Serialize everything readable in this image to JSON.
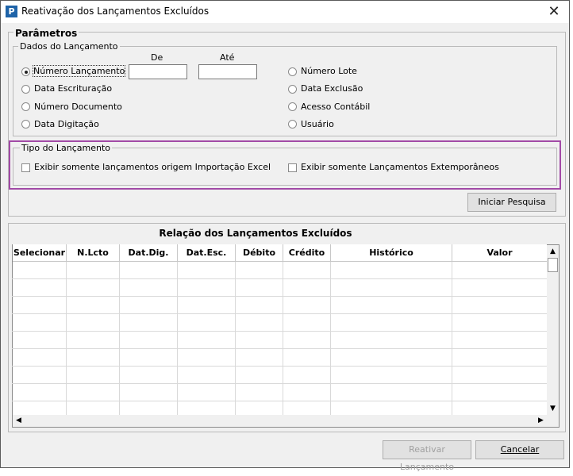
{
  "window": {
    "title": "Reativação dos Lançamentos Excluídos",
    "close_glyph": "✕",
    "app_icon_letter": "P"
  },
  "params": {
    "title": "Parâmetros",
    "dados": {
      "legend": "Dados do Lançamento",
      "col_de": "De",
      "col_ate": "Até",
      "left_options": [
        "Número Lançamento",
        "Data Escrituração",
        "Número Documento",
        "Data Digitação"
      ],
      "right_options": [
        "Número Lote",
        "Data Exclusão",
        "Acesso Contábil",
        "Usuário"
      ],
      "de_value": "",
      "ate_value": ""
    },
    "tipo": {
      "legend": "Tipo do Lançamento",
      "opt1": "Exibir somente lançamentos origem Importação Excel",
      "opt2": "Exibir somente Lançamentos Extemporâneos"
    },
    "search_button": "Iniciar Pesquisa"
  },
  "relacao": {
    "title": "Relação dos Lançamentos Excluídos",
    "columns": [
      "Selecionar",
      "N.Lcto",
      "Dat.Dig.",
      "Dat.Esc.",
      "Débito",
      "Crédito",
      "Histórico",
      "Valor"
    ],
    "rows": []
  },
  "footer": {
    "reativar": "Reativar Lançamento",
    "cancelar": "Cancelar"
  },
  "colors": {
    "highlight_border": "#a24aa6",
    "icon_blue": "#1e63a8"
  }
}
